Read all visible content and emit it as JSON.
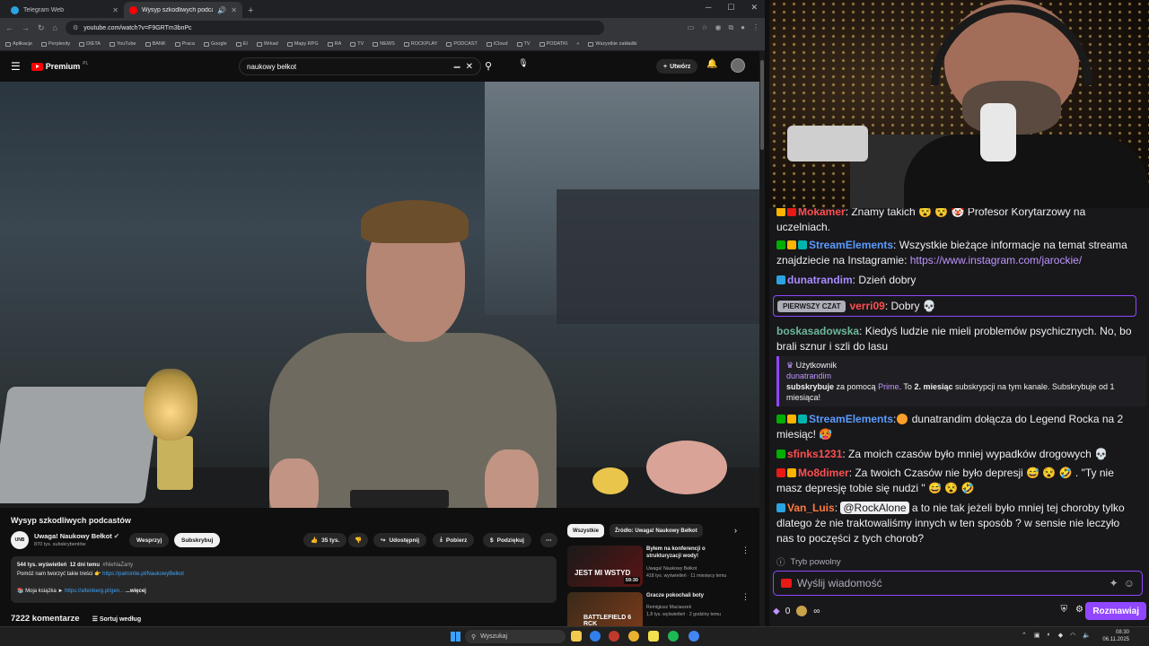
{
  "browser": {
    "tabs": [
      {
        "title": "Telegram Web",
        "color": "#2aa3e0"
      },
      {
        "title": "Wysyp szkodliwych podcastów",
        "color": "#ff0000"
      }
    ],
    "new_tab": "+",
    "url": "youtube.com/watch?v=F9GRTm3bnPc",
    "bookmarks": [
      "Aplikacje",
      "Perplexity",
      "DIETA",
      "YouTube",
      "BANK",
      "Praca",
      "Google",
      "EI",
      "Wrkad",
      "Mapy RPG",
      "RA",
      "TV",
      "NEWS",
      "ROCKPLAY",
      "PODCAST",
      "iCloud",
      "TV",
      "PODATKI"
    ],
    "bookmarks_more": "»",
    "all_bookmarks": "Wszystkie zakładki"
  },
  "youtube": {
    "logo_text": "Premium",
    "logo_sup": "PL",
    "search_value": "naukowy bełkot",
    "create_label": "Utwórz",
    "video_title": "Wysyp szkodliwych podcastów",
    "channel": {
      "avatar_text": "UNB",
      "name": "Uwaga! Naukowy Bełkot",
      "subs": "870 tys. subskrybentów",
      "support_label": "Wesprzyj",
      "subscribe_label": "Subskrybuj"
    },
    "likes": "35 tys.",
    "share_label": "Udostępnij",
    "download_label": "Pobierz",
    "thanks_label": "Podziękuj",
    "description": {
      "views": "544 tys. wyświetleń",
      "date": "12 dni temu",
      "hashtag": "#NieNaŻarty",
      "line1": "Pomóż nam tworzyć takie treści 👉",
      "link1": "https://patronite.pl/NaukowyBelkot",
      "line2": "📚 Moja książka ►",
      "link2": "https://altenberg.pl/gen...",
      "more": "...więcej"
    },
    "comments_count": "7222 komentarze",
    "sort_label": "Sortuj według",
    "chips": [
      "Wszystkie",
      "Źródło: Uwaga! Naukowy Bełkot"
    ],
    "related": [
      {
        "title": "Byłem na konferencji o strukturyzacji wody!",
        "channel": "Uwaga! Naukowy Bełkot",
        "meta": "418 tys. wyświetleń · 11 miesięcy temu",
        "duration": "59:30",
        "thumb_text": "JEST MI WSTYD"
      },
      {
        "title": "Gracze pokochali boty",
        "channel": "Remigiusz Maciaszek",
        "meta": "1,8 tys. wyświetleń · 2 godziny temu",
        "duration": "",
        "thumb_text": "BATTLEFIELD 6 RCK"
      }
    ]
  },
  "chat": {
    "messages": [
      {
        "user": "Mokamer",
        "color": "#ff4f4f",
        "text": ": Znamy takich 😵 😵 🤡 Profesor Korytarzowy na uczelniach."
      },
      {
        "user": "StreamElements",
        "color": "#5b9bff",
        "text": ": Wszystkie bieżące informacje na temat streama znajdziecie na Instagramie: ",
        "link": "https://www.instagram.com/jarockie/"
      },
      {
        "user": "dunatrandim",
        "color": "#a98bff",
        "text": ": Dzień dobry"
      },
      {
        "user": "boskasadowska",
        "color": "#6cb89a",
        "text": ": Kiedyś ludzie nie mieli problemów psychicznych. No, bo brali sznur i szli do lasu"
      },
      {
        "user": "StreamElements",
        "color": "#5b9bff",
        "text": " dunatrandim dołącza do Legend Rocka na 2 miesiąc! 🥵"
      },
      {
        "user": "sfinks1231",
        "color": "#ff4f4f",
        "text": ": Za moich czasów było mniej wypadków drogowych 💀"
      },
      {
        "user": "Mo8dimer",
        "color": "#ff4f4f",
        "text": ": Za twoich Czasów nie było depresji 😅 😵 🤣 . \"Ty nie masz depresję tobie się nudzi \" 😅 😵 🤣"
      },
      {
        "user": "Van_Luis",
        "color": "#ff7a3d",
        "mention": "@RockAlone",
        "text": " a to nie tak jeżeli było mniej tej choroby tylko dlatego że nie traktowaliśmy innych w ten sposób ? w sensie nie leczyło nas to poczęści z tych chorob?"
      }
    ],
    "first_chat": {
      "badge": "PIERWSZY CZAT",
      "user": "verri09",
      "text": ": Dobry 💀"
    },
    "sub_notice": {
      "label": "Użytkownik",
      "user": "dunatrandim",
      "action": "subskrybuje",
      "text1": " za pomocą ",
      "prime": "Prime",
      "text2": ". To ",
      "months": "2. miesiąc",
      "text3": " subskrypcji na tym kanale. Subskrybuje od 1 miesiąca!"
    },
    "slow_mode": "Tryb powolny",
    "input_placeholder": "Wyślij wiadomość",
    "points": "0",
    "points_inf": "∞",
    "chat_button": "Rozmawiaj"
  },
  "taskbar": {
    "search_placeholder": "Wyszukaj",
    "time": "08:30",
    "date": "06.11.2025"
  }
}
